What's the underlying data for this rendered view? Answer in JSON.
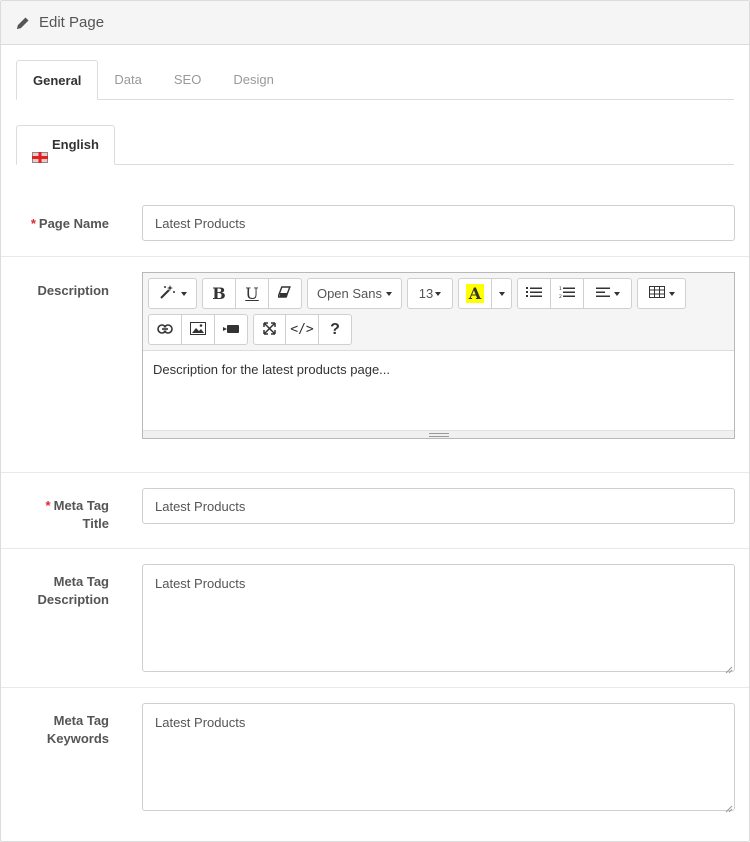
{
  "header": {
    "title": "Edit Page",
    "icon": "pencil-icon"
  },
  "tabs": [
    {
      "label": "General",
      "active": true
    },
    {
      "label": "Data",
      "active": false
    },
    {
      "label": "SEO",
      "active": false
    },
    {
      "label": "Design",
      "active": false
    }
  ],
  "language_tab": {
    "label": "English",
    "icon": "flag-uk-icon"
  },
  "fields": {
    "page_name": {
      "label": "Page Name",
      "required_mark": "*",
      "value": "Latest Products"
    },
    "description": {
      "label": "Description",
      "value": "Description for the latest products page...",
      "toolbar": {
        "font_family": "Open Sans",
        "font_size": "13",
        "bold": "B",
        "underline": "U",
        "highlight": "A",
        "code": "</>",
        "help": "?"
      }
    },
    "meta_title": {
      "label_line1": "Meta Tag",
      "label_line2": "Title",
      "required_mark": "*",
      "value": "Latest Products"
    },
    "meta_description": {
      "label_line1": "Meta Tag",
      "label_line2": "Description",
      "value": "Latest Products"
    },
    "meta_keywords": {
      "label_line1": "Meta Tag",
      "label_line2": "Keywords",
      "value": "Latest Products"
    }
  },
  "colors": {
    "required": "#e3242b",
    "highlight": "#ffff00",
    "border": "#dcdcdc"
  }
}
